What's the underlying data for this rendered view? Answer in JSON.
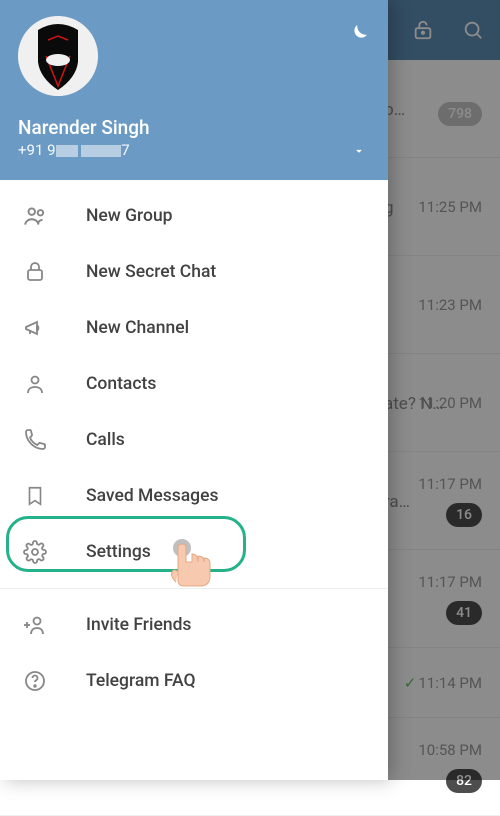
{
  "user": {
    "name": "Narender Singh",
    "phone_prefix": "+91 9",
    "phone_suffix": "7"
  },
  "menu": {
    "new_group": "New Group",
    "new_secret_chat": "New Secret Chat",
    "new_channel": "New Channel",
    "contacts": "Contacts",
    "calls": "Calls",
    "saved_messages": "Saved Messages",
    "settings": "Settings",
    "invite_friends": "Invite Friends",
    "telegram_faq": "Telegram FAQ"
  },
  "chats": [
    {
      "snippet": "o…",
      "time": "",
      "badge": "798"
    },
    {
      "snippet": "g",
      "time": "11:25 PM",
      "badge": ""
    },
    {
      "snippet": "",
      "time": "11:23 PM",
      "badge": ""
    },
    {
      "snippet": "ate? N…",
      "time": "11:20 PM",
      "badge": ""
    },
    {
      "snippet": "ra…",
      "time": "11:17 PM",
      "badge": "16"
    },
    {
      "snippet": "",
      "time": "11:17 PM",
      "badge": "41"
    },
    {
      "snippet": "",
      "time": "11:14 PM",
      "badge": "",
      "checked": true
    },
    {
      "snippet": "",
      "time": "10:58 PM",
      "badge": "82"
    }
  ]
}
